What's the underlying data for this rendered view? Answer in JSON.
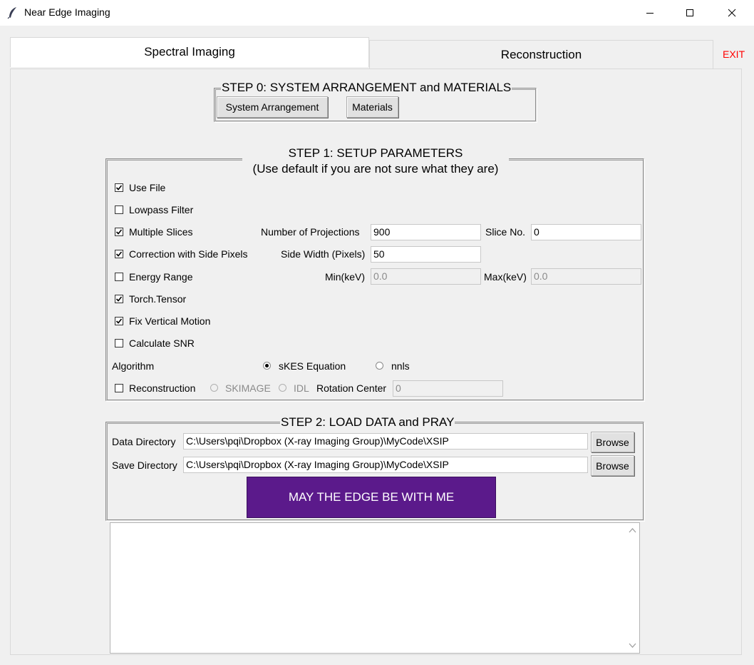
{
  "window": {
    "title": "Near Edge Imaging",
    "icon": "feather-icon"
  },
  "tabs": [
    {
      "label": "Spectral Imaging",
      "selected": true
    },
    {
      "label": "Reconstruction",
      "selected": false
    }
  ],
  "exit_label": "EXIT",
  "step0": {
    "legend": "STEP 0: SYSTEM ARRANGEMENT and MATERIALS",
    "system_arrangement_label": "System Arrangement",
    "materials_label": "Materials"
  },
  "step1": {
    "legend_line1": "STEP 1: SETUP PARAMETERS",
    "legend_line2": "(Use default if you are not sure what they are)",
    "checkboxes": [
      {
        "label": "Use File",
        "checked": true
      },
      {
        "label": "Lowpass Filter",
        "checked": false
      },
      {
        "label": "Multiple Slices",
        "checked": true
      },
      {
        "label": "Correction with Side Pixels",
        "checked": true
      },
      {
        "label": "Energy Range",
        "checked": false
      },
      {
        "label": "Torch.Tensor",
        "checked": true
      },
      {
        "label": "Fix Vertical Motion",
        "checked": true
      },
      {
        "label": "Calculate SNR",
        "checked": false
      }
    ],
    "num_projections_label": "Number of Projections",
    "num_projections_value": "900",
    "slice_no_label": "Slice No.",
    "slice_no_value": "0",
    "side_width_label": "Side Width (Pixels)",
    "side_width_value": "50",
    "min_kev_label": "Min(keV)",
    "min_kev_value": "0.0",
    "max_kev_label": "Max(keV)",
    "max_kev_value": "0.0",
    "algorithm_label": "Algorithm",
    "algorithm_options": [
      {
        "label": "sKES Equation",
        "selected": true
      },
      {
        "label": "nnls",
        "selected": false
      }
    ],
    "reconstruction": {
      "label": "Reconstruction",
      "checked": false
    },
    "recon_options": [
      {
        "label": "SKIMAGE",
        "selected": false
      },
      {
        "label": "IDL",
        "selected": false
      }
    ],
    "rotation_center_label": "Rotation Center",
    "rotation_center_value": "0"
  },
  "step2": {
    "legend": "STEP 2: LOAD DATA and PRAY",
    "data_dir_label": "Data Directory",
    "data_dir_value": "C:\\Users\\pqi\\Dropbox (X-ray Imaging Group)\\MyCode\\XSIP",
    "save_dir_label": "Save Directory",
    "save_dir_value": "C:\\Users\\pqi\\Dropbox (X-ray Imaging Group)\\MyCode\\XSIP",
    "browse_label": "Browse",
    "run_label": "MAY THE EDGE BE WITH ME"
  },
  "colors": {
    "run_button": "#5b1a8b",
    "exit": "#ff0000"
  }
}
